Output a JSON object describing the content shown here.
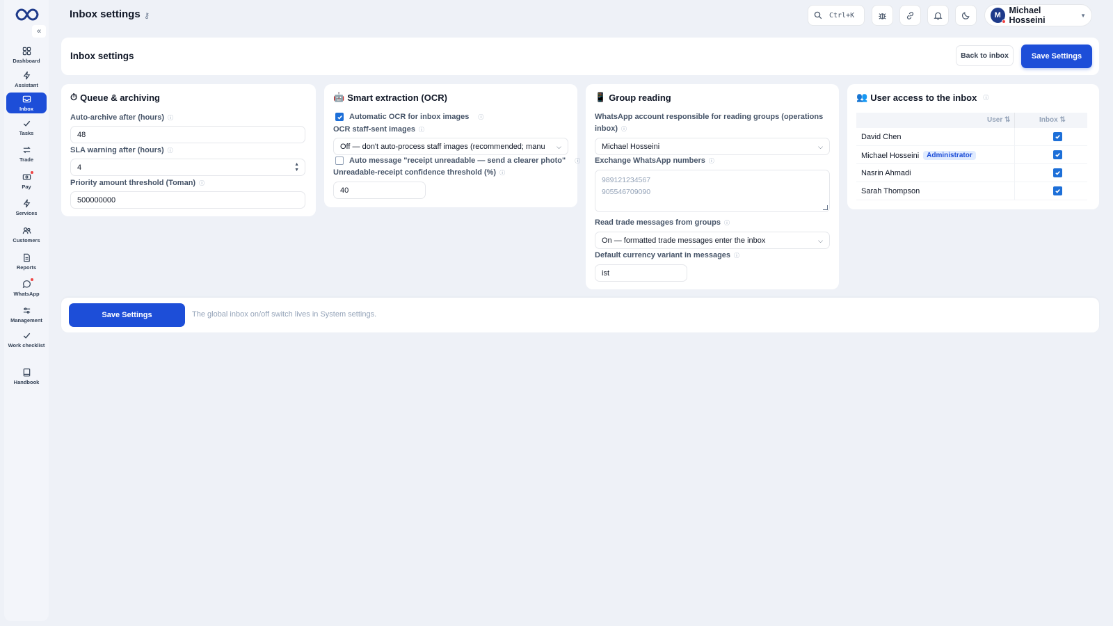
{
  "topbar": {
    "title": "Inbox settings",
    "title_key_glyph": "⚷",
    "search_shortcut": "Ctrl+K",
    "user_initial": "M",
    "user_name": "Michael Hosseini"
  },
  "sidebar": {
    "collapse_glyph": "«",
    "items": [
      {
        "label": "Dashboard",
        "icon": "dashboard-icon"
      },
      {
        "label": "Assistant",
        "icon": "bolt-icon"
      },
      {
        "label": "Inbox",
        "icon": "inbox-icon",
        "active": true
      },
      {
        "label": "Tasks",
        "icon": "check-icon"
      },
      {
        "label": "Trade",
        "icon": "swap-icon"
      },
      {
        "label": "Pay",
        "icon": "cash-icon",
        "dot": true
      },
      {
        "label": "Services",
        "icon": "bolt-icon"
      },
      {
        "label": "Customers",
        "icon": "users-icon"
      },
      {
        "label": "Reports",
        "icon": "file-icon"
      },
      {
        "label": "WhatsApp",
        "icon": "chat-icon",
        "dot": true
      },
      {
        "label": "Management",
        "icon": "sliders-icon"
      },
      {
        "label": "Work checklist",
        "icon": "check-icon"
      },
      {
        "label": "Handbook",
        "icon": "book-icon"
      }
    ]
  },
  "header": {
    "title": "Inbox settings",
    "back_label": "Back to inbox",
    "save_label": "Save Settings"
  },
  "queue": {
    "emoji": "⏱",
    "title": "Queue & archiving",
    "auto_archive_label": "Auto-archive after (hours)",
    "auto_archive_value": "48",
    "sla_label": "SLA warning after (hours)",
    "sla_value": "4",
    "priority_label": "Priority amount threshold (Toman)",
    "priority_value": "500000000"
  },
  "ocr": {
    "emoji": "🤖",
    "title": "Smart extraction (OCR)",
    "auto_ocr_label": "Automatic OCR for inbox images",
    "auto_ocr_checked": true,
    "staff_label": "OCR staff-sent images",
    "staff_value": "Off — don't auto-process staff images (recommended; manu",
    "auto_msg_label": "Auto message \"receipt unreadable — send a clearer photo\"",
    "auto_msg_checked": false,
    "threshold_label": "Unreadable-receipt confidence threshold (%)",
    "threshold_value": "40"
  },
  "group": {
    "emoji": "📱",
    "title": "Group reading",
    "account_label_line1": "WhatsApp account responsible for reading groups (operations",
    "account_label_line2": "inbox)",
    "account_value": "Michael Hosseini",
    "exchange_label": "Exchange WhatsApp numbers",
    "exchange_line1": "989121234567",
    "exchange_line2": "905546709090",
    "read_trade_label": "Read trade messages from groups",
    "read_trade_value": "On — formatted trade messages enter the inbox",
    "currency_label": "Default currency variant in messages",
    "currency_value": "ist"
  },
  "access": {
    "emoji": "👥",
    "title": "User access to the inbox",
    "col_user": "User ⇅",
    "col_inbox": "Inbox ⇅",
    "users": [
      {
        "name": "David Chen",
        "badge": "",
        "inbox": true
      },
      {
        "name": "Michael Hosseini",
        "badge": "Administrator",
        "inbox": true
      },
      {
        "name": "Nasrin Ahmadi",
        "badge": "",
        "inbox": true
      },
      {
        "name": "Sarah Thompson",
        "badge": "",
        "inbox": true
      }
    ]
  },
  "footer": {
    "save_label": "Save Settings",
    "note": "The global inbox on/off switch lives in System settings."
  },
  "colors": {
    "primary": "#1d4ed8",
    "background": "#eef1f7",
    "badge_bg": "#e0ebff"
  }
}
